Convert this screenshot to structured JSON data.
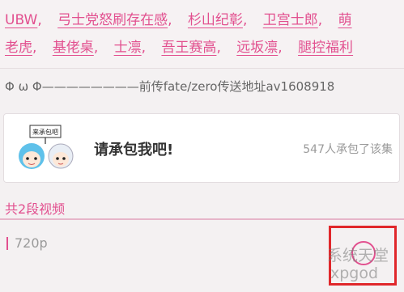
{
  "tags": {
    "line1": [
      "UBW",
      "弓士党怒刷存在感",
      "杉山纪彰",
      "卫宫士郎",
      "萌"
    ],
    "line2": [
      "老虎",
      "基佬桌",
      "士凛",
      "吾王赛高",
      "远坂凛",
      "腿控福利"
    ]
  },
  "description": "Φ ω Φ————————前传fate/zero传送地址av1608918",
  "card": {
    "sign_text": "来承包吧",
    "title": "请承包我吧!",
    "count_text": "547人承包了该集"
  },
  "section_title": "共2段视频",
  "video": {
    "quality": "720p"
  },
  "icons": {
    "download": "download-circle-icon"
  },
  "watermark": {
    "line1": "系统天堂",
    "line2": "xpgod"
  },
  "colors": {
    "accent": "#e2508f",
    "highlight": "#e0272b"
  }
}
